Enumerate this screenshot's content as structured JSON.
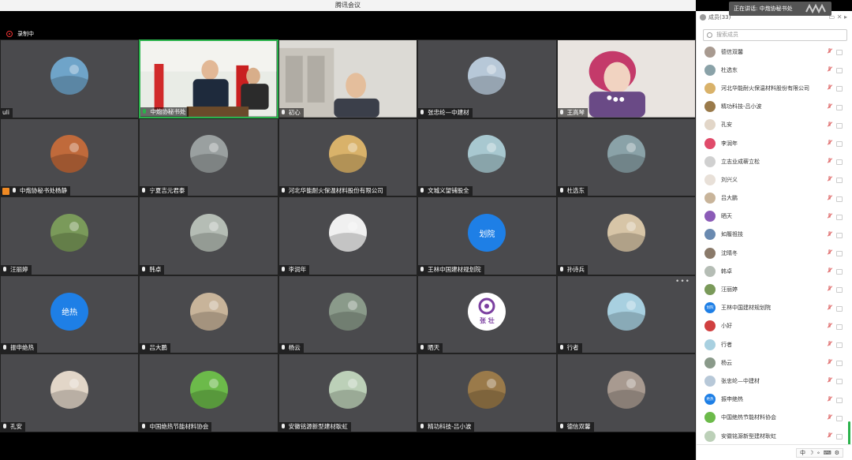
{
  "window": {
    "title": "腾讯会议",
    "speaking_label": "正在讲话: 中炮协秘书处"
  },
  "recording": {
    "label": "录制中"
  },
  "tiles": [
    {
      "name": "uli",
      "type": "avatar",
      "color": "#6fa4c9"
    },
    {
      "name": "中炮协秘书处",
      "type": "video",
      "active": true
    },
    {
      "name": "初心",
      "type": "video"
    },
    {
      "name": "张忠纶—中建材",
      "type": "avatar",
      "color": "#b7c8d8"
    },
    {
      "name": "王高琴",
      "type": "video"
    },
    {
      "name": "中炮协秘书处杨静",
      "type": "avatar",
      "color": "#c06a3b",
      "host": true
    },
    {
      "name": "宁夏吉元君泰",
      "type": "avatar",
      "color": "#9aa0a0"
    },
    {
      "name": "河北华能耐火保温材料股份有限公司",
      "type": "avatar",
      "color": "#d9b26a"
    },
    {
      "name": "文城义望铺股全",
      "type": "avatar",
      "color": "#a8c8d0"
    },
    {
      "name": "杜选东",
      "type": "avatar",
      "color": "#8aa2a8"
    },
    {
      "name": "汪丽婷",
      "type": "avatar",
      "color": "#7a9a5a"
    },
    {
      "name": "韩卓",
      "type": "avatar",
      "color": "#b5bdb5"
    },
    {
      "name": "李润年",
      "type": "avatar",
      "color": "#f0f0f0"
    },
    {
      "name": "王林中国建材规划院",
      "type": "text",
      "label": "划院"
    },
    {
      "name": "孙诗兵",
      "type": "avatar",
      "color": "#d7c5a7"
    },
    {
      "name": "振申绝热",
      "type": "text",
      "label": "绝热"
    },
    {
      "name": "吕大鹏",
      "type": "avatar",
      "color": "#c8b49a"
    },
    {
      "name": "杨云",
      "type": "avatar",
      "color": "#8a9a8a"
    },
    {
      "name": "晒天",
      "type": "logo",
      "label": "张 壮"
    },
    {
      "name": "行者",
      "type": "avatar",
      "color": "#a8d0e0"
    },
    {
      "name": "孔安",
      "type": "avatar",
      "color": "#e2d6c8"
    },
    {
      "name": "中国绝热节能材料协会",
      "type": "avatar",
      "color": "#6cba4a"
    },
    {
      "name": "安徽铭源新型建材耿虹",
      "type": "avatar",
      "color": "#bcd0b8"
    },
    {
      "name": "精功科技-吕小波",
      "type": "avatar",
      "color": "#9a7a4a"
    },
    {
      "name": "德信双馨",
      "type": "avatar",
      "color": "#a89a90"
    }
  ],
  "panel": {
    "title": "成员(33)",
    "search_placeholder": "搜索成员",
    "members": [
      {
        "name": "德信双馨",
        "color": "#a89a90"
      },
      {
        "name": "杜选东",
        "color": "#8aa2a8"
      },
      {
        "name": "河北华能耐火保温材料股份有限公司",
        "color": "#d9b26a"
      },
      {
        "name": "精功科技-吕小波",
        "color": "#9a7a4a"
      },
      {
        "name": "孔安",
        "color": "#e2d6c8"
      },
      {
        "name": "李润年",
        "color": "#e04b6a"
      },
      {
        "name": "立志业成蕲立松",
        "color": "#d0d0d0"
      },
      {
        "name": "刘兴义",
        "color": "#e8e0d8"
      },
      {
        "name": "吕大鹏",
        "color": "#c8b49a"
      },
      {
        "name": "晒天",
        "color": "#8b5bb7"
      },
      {
        "name": "如履祖技",
        "color": "#6a8ab0"
      },
      {
        "name": "沈晴冬",
        "color": "#8a7a6a"
      },
      {
        "name": "韩卓",
        "color": "#b5bdb5"
      },
      {
        "name": "汪丽婷",
        "color": "#7a9a5a"
      },
      {
        "name": "王林中国建材规划院",
        "color": "#1e7fe6",
        "text": "划院"
      },
      {
        "name": "小好",
        "color": "#d04040"
      },
      {
        "name": "行者",
        "color": "#a8d0e0"
      },
      {
        "name": "杨云",
        "color": "#8a9a8a"
      },
      {
        "name": "张忠纶—中建材",
        "color": "#b7c8d8"
      },
      {
        "name": "振申绝热",
        "color": "#1e7fe6",
        "text": "绝热"
      },
      {
        "name": "中国绝热节能材料协会",
        "color": "#6cba4a"
      },
      {
        "name": "安徽铭源新型建材耿虹",
        "color": "#bcd0b8"
      }
    ],
    "ime": [
      "中",
      "☽",
      "∘",
      "⌨",
      "⚙"
    ]
  }
}
